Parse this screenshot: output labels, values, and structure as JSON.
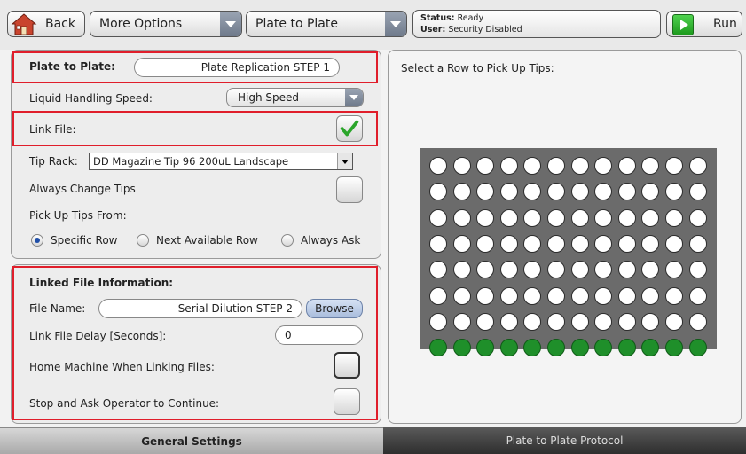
{
  "toolbar": {
    "back_label": "Back",
    "more_options_label": "More Options",
    "mode_label": "Plate to Plate",
    "status_label": "Status:",
    "status_value": "Ready",
    "user_label": "User:",
    "user_value": "Security Disabled",
    "run_label": "Run"
  },
  "settings": {
    "plate_to_plate_label": "Plate to Plate:",
    "plate_to_plate_value": "Plate Replication STEP 1",
    "speed_label": "Liquid Handling Speed:",
    "speed_value": "High Speed",
    "link_file_label": "Link File:",
    "link_file_checked": true,
    "tip_rack_label": "Tip Rack:",
    "tip_rack_value": "DD Magazine Tip 96 200uL Landscape",
    "always_change_label": "Always Change Tips",
    "always_change_checked": false,
    "pick_up_label": "Pick Up Tips From:",
    "pick_options": [
      "Specific Row",
      "Next Available Row",
      "Always Ask"
    ],
    "pick_selected": "Specific Row"
  },
  "linked": {
    "heading": "Linked File Information:",
    "file_name_label": "File Name:",
    "file_name_value": "Serial Dilution STEP 2",
    "browse_label": "Browse",
    "delay_label": "Link File Delay [Seconds]:",
    "delay_value": "0",
    "home_label": "Home Machine When Linking Files:",
    "home_checked": false,
    "stop_label": "Stop and Ask Operator to Continue:",
    "stop_checked": false
  },
  "plate": {
    "instruction": "Select a Row to Pick Up Tips:",
    "rows": 8,
    "cols": 12,
    "selected_row": 8,
    "colors": {
      "empty": "#ffffff",
      "selected": "#1f8f2a"
    }
  },
  "tabs": {
    "general": "General Settings",
    "protocol": "Plate to Plate Protocol"
  },
  "colors": {
    "highlight": "#e01e2b",
    "accent_green": "#2aa52a"
  },
  "icons": {
    "back": "house-icon",
    "run": "play-icon",
    "check": "checkmark-icon"
  }
}
